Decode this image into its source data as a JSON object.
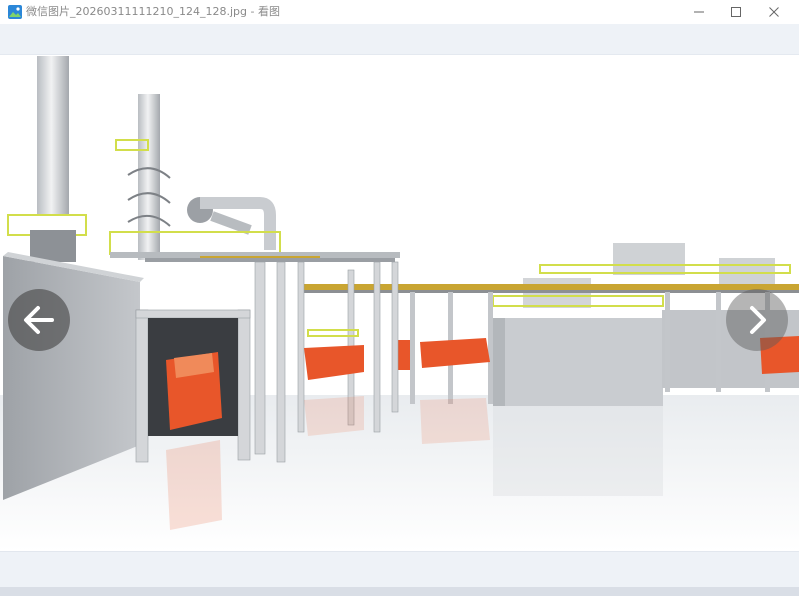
{
  "window": {
    "title": "微信图片_20260311111210_124_128.jpg - 看图",
    "buttons": {
      "minimize": "minimize-icon",
      "maximize": "maximize-icon",
      "close": "close-icon"
    }
  },
  "viewer": {
    "prev_icon": "arrow-left-icon",
    "next_icon": "chevron-right-icon"
  },
  "colors": {
    "accent_orange": "#e8562a",
    "safety_yellow": "#d4e04a",
    "wall_gray": "#a9adb2",
    "toolbar_bg": "#eef2f7"
  }
}
